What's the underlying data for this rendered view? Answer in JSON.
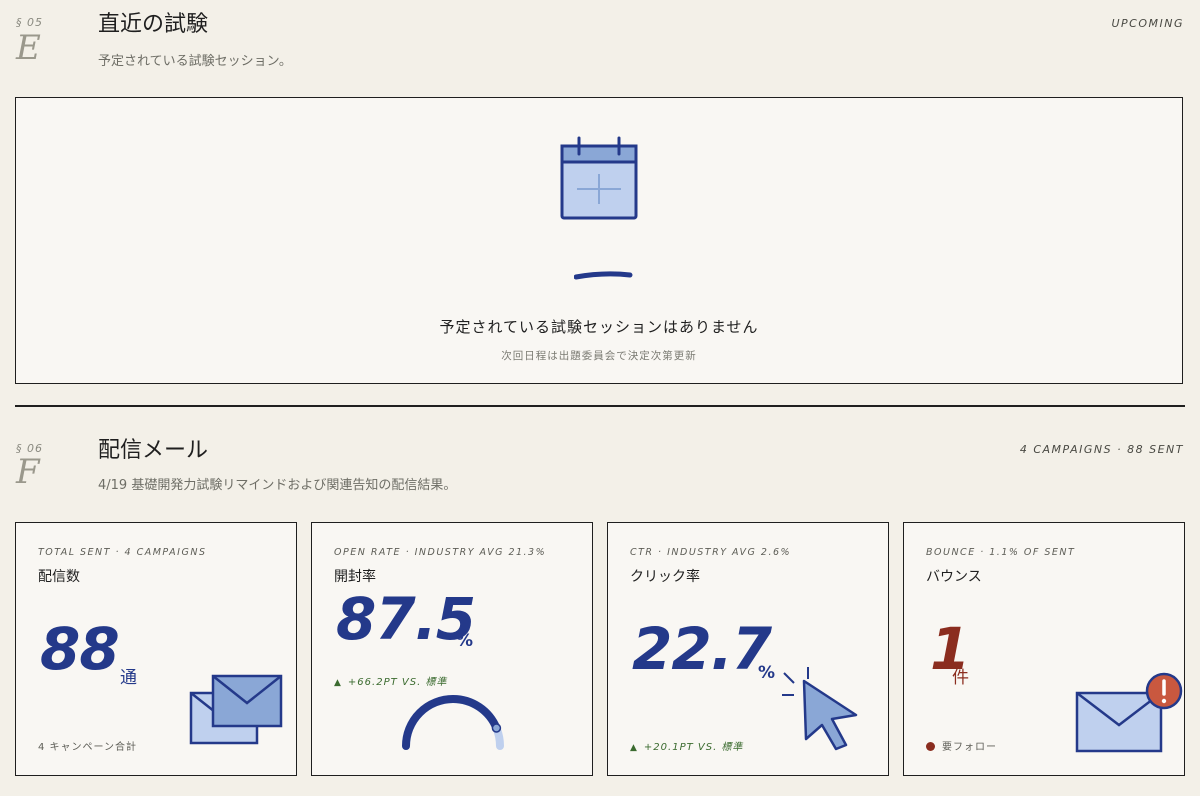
{
  "section_e": {
    "number": "§ 05",
    "letter": "E",
    "title": "直近の試験",
    "subtitle": "予定されている試験セッション。",
    "tag": "UPCOMING",
    "empty_title": "予定されている試験セッションはありません",
    "empty_sub": "次回日程は出題委員会で決定次第更新"
  },
  "section_f": {
    "number": "§ 06",
    "letter": "F",
    "title": "配信メール",
    "subtitle": "4/19 基礎開発力試験リマインドおよび関連告知の配信結果。",
    "tag": "4 CAMPAIGNS · 88 SENT"
  },
  "cards": [
    {
      "label": "TOTAL SENT · 4 CAMPAIGNS",
      "title": "配信数",
      "value": "88",
      "unit": "通",
      "foot": "4 キャンペーン合計"
    },
    {
      "label": "OPEN RATE · INDUSTRY AVG 21.3%",
      "title": "開封率",
      "value": "87.5",
      "unit": "%",
      "foot_arrow": "▲",
      "foot": "+66.2PT VS. 標準",
      "gauge_fraction": 0.875
    },
    {
      "label": "CTR · INDUSTRY AVG 2.6%",
      "title": "クリック率",
      "value": "22.7",
      "unit": "%",
      "foot_arrow": "▲",
      "foot": "+20.1PT VS. 標準"
    },
    {
      "label": "BOUNCE · 1.1% OF SENT",
      "title": "バウンス",
      "value": "1",
      "unit": "件",
      "foot": "要フォロー"
    }
  ],
  "colors": {
    "background": "#f3f0e8",
    "card": "#f9f7f3",
    "accent_blue": "#24398a",
    "light_blue": "#bfd0ee",
    "mid_blue": "#8aa7d6",
    "bounce_red": "#8b2d1f",
    "alert_orange": "#c9583f",
    "positive_green": "#3b6b2f"
  },
  "icons": [
    "calendar-plus-icon",
    "envelope-stack-icon",
    "gauge-icon",
    "cursor-click-icon",
    "envelope-alert-icon"
  ]
}
